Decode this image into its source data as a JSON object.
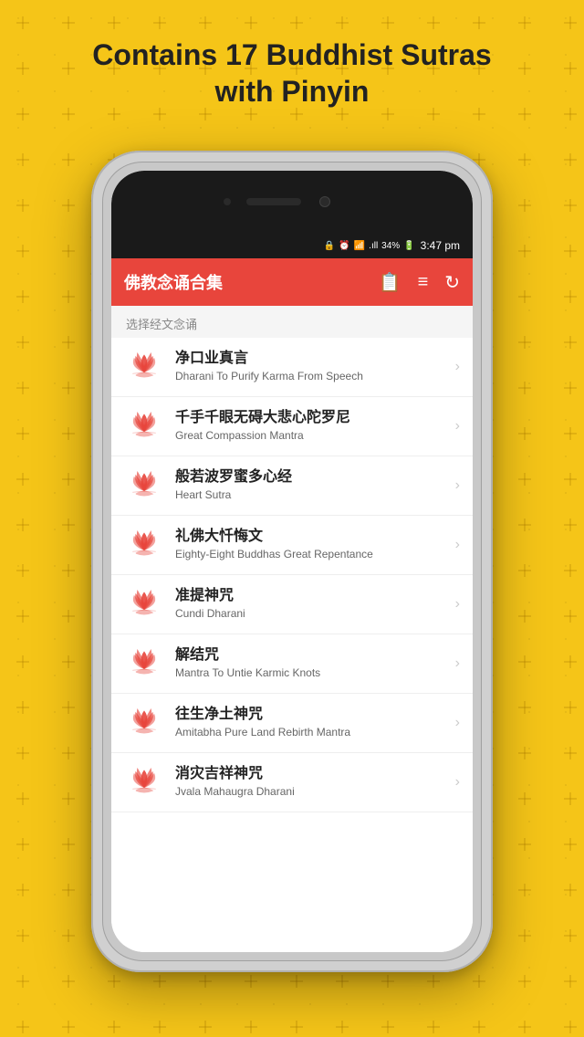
{
  "page": {
    "title_line1": "Contains 17 Buddhist Sutras",
    "title_line2": "with Pinyin",
    "background_color": "#F5C518"
  },
  "status_bar": {
    "icons": "🔒 ⏰ 📶 34%🔋",
    "time": "3:47 pm",
    "battery": "34%"
  },
  "app": {
    "title": "佛教念诵合集",
    "icon_list": "≡",
    "icon_notes": "📋",
    "section_label": "选择经文念诵"
  },
  "items": [
    {
      "cn": "净口业真言",
      "en": "Dharani To Purify Karma From Speech"
    },
    {
      "cn": "千手千眼无碍大悲心陀罗尼",
      "en": "Great Compassion Mantra"
    },
    {
      "cn": "般若波罗蜜多心经",
      "en": "Heart Sutra"
    },
    {
      "cn": "礼佛大忏悔文",
      "en": "Eighty-Eight Buddhas Great Repentance"
    },
    {
      "cn": "准提神咒",
      "en": "Cundi Dharani"
    },
    {
      "cn": "解结咒",
      "en": "Mantra To Untie Karmic Knots"
    },
    {
      "cn": "往生净土神咒",
      "en": "Amitabha Pure Land Rebirth Mantra"
    },
    {
      "cn": "消灾吉祥神咒",
      "en": "Jvala Mahaugra Dharani"
    }
  ]
}
